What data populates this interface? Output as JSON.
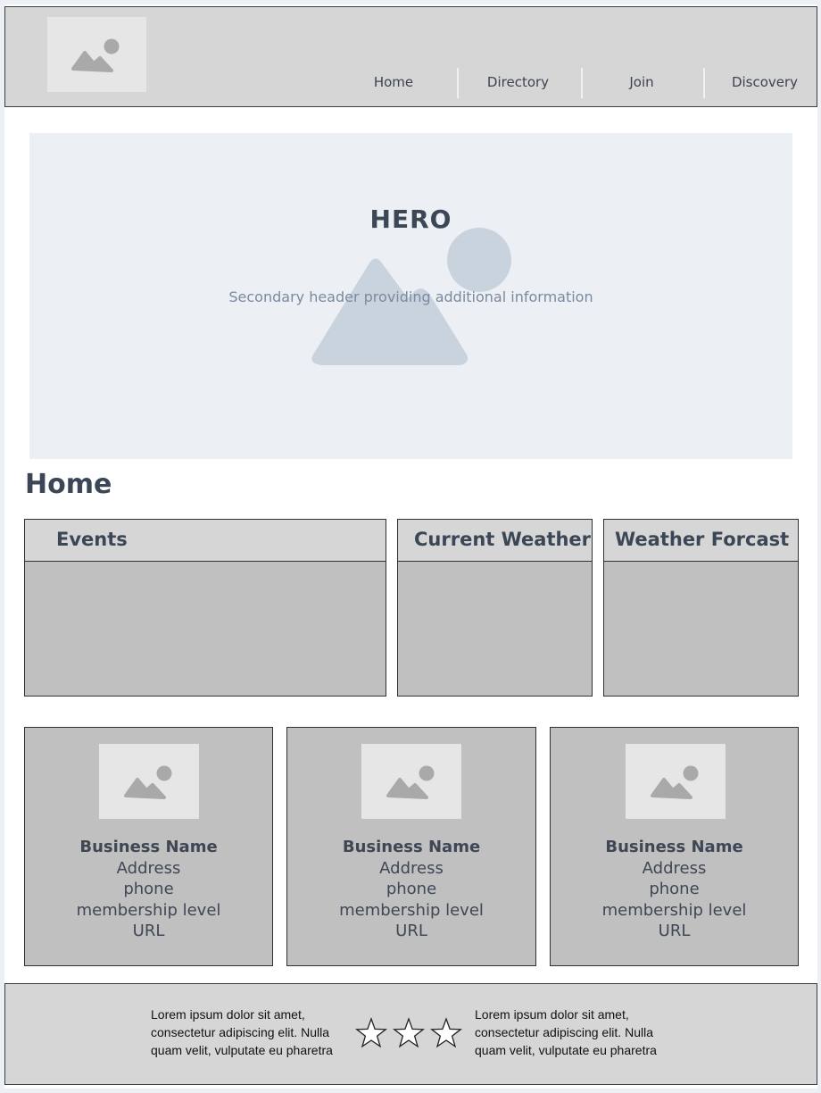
{
  "header": {
    "logo_icon": "image-placeholder-icon",
    "nav": [
      {
        "label": "Home"
      },
      {
        "label": "Directory"
      },
      {
        "label": "Join"
      },
      {
        "label": "Discovery"
      }
    ]
  },
  "hero": {
    "title": "HERO",
    "subtitle": "Secondary header providing additional information",
    "background_icon": "image-placeholder-icon"
  },
  "main": {
    "title": "Home",
    "panels": [
      {
        "title": "Events"
      },
      {
        "title": "Current Weather"
      },
      {
        "title": "Weather Forcast"
      }
    ],
    "businesses": [
      {
        "name": "Business Name",
        "address": "Address",
        "phone": "phone",
        "membership": "membership level",
        "url": "URL"
      },
      {
        "name": "Business Name",
        "address": "Address",
        "phone": "phone",
        "membership": "membership level",
        "url": "URL"
      },
      {
        "name": "Business Name",
        "address": "Address",
        "phone": "phone",
        "membership": "membership level",
        "url": "URL"
      }
    ]
  },
  "footer": {
    "left_text": "Lorem ipsum dolor sit amet, consectetur adipiscing elit. Nulla quam velit, vulputate eu pharetra nec, mattis ac neque. Duis",
    "right_text": "Lorem ipsum dolor sit amet, consectetur adipiscing elit. Nulla quam velit, vulputate eu pharetra nec, mattis ac neque. Duis",
    "rating_icon": "star-icon",
    "rating": "3 of 3"
  },
  "colors": {
    "header_bg": "#d6d6d6",
    "hero_bg": "#eceff3",
    "panel_bg": "#c0c0c0",
    "text_dark": "#3b4656",
    "text_muted": "#7a8aa0"
  }
}
